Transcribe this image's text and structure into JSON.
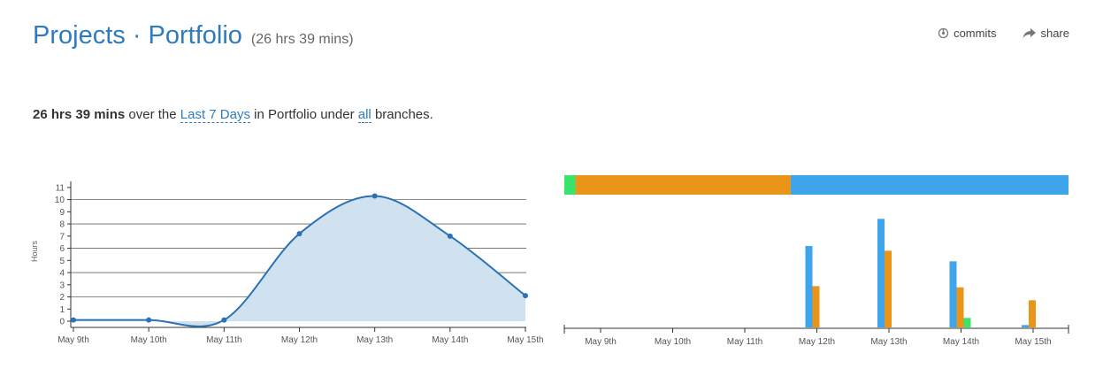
{
  "header": {
    "title": "Projects · Portfolio",
    "subtitle": "(26 hrs 39 mins)",
    "commits_label": "commits",
    "share_label": "share",
    "commits_icon": "commit-icon",
    "share_icon": "share-arrow-icon"
  },
  "summary": {
    "total": "26 hrs 39 mins",
    "text_over": "over the",
    "range_link": "Last 7 Days",
    "text_in": "in Portfolio under",
    "branch_link": "all",
    "text_end": "branches."
  },
  "colors": {
    "title": "#2f7bbf",
    "line": "#2a72b4",
    "area": "#d0e2f0",
    "blue": "#3ea5ea",
    "orange": "#ea951a",
    "green": "#3ae36a"
  },
  "chart_data": [
    {
      "type": "area",
      "ylabel": "Hours",
      "xlabel": "",
      "categories": [
        "May 9th",
        "May 10th",
        "May 11th",
        "May 12th",
        "May 13th",
        "May 14th",
        "May 15th"
      ],
      "values": [
        0.1,
        0.1,
        0.1,
        7.2,
        10.3,
        7.0,
        2.1
      ],
      "yticks": [
        0,
        1,
        2,
        3,
        4,
        5,
        6,
        7,
        8,
        9,
        10,
        11
      ],
      "ylim": [
        0,
        11.5
      ],
      "grid": true
    },
    {
      "type": "bar",
      "stacked_summary": [
        {
          "color": "green",
          "fraction": 0.022
        },
        {
          "color": "orange",
          "fraction": 0.427
        },
        {
          "color": "blue",
          "fraction": 0.551
        }
      ],
      "categories": [
        "May 9th",
        "May 10th",
        "May 11th",
        "May 12th",
        "May 13th",
        "May 14th",
        "May 15th"
      ],
      "series": [
        {
          "color": "blue",
          "values": [
            0,
            0,
            0,
            6.9,
            9.2,
            5.6,
            0.2
          ]
        },
        {
          "color": "orange",
          "values": [
            0,
            0,
            0,
            3.5,
            6.5,
            3.4,
            2.3
          ]
        },
        {
          "color": "green",
          "values": [
            0,
            0,
            0,
            0,
            0,
            0.8,
            0
          ]
        }
      ],
      "ylim": [
        0,
        10.5
      ]
    }
  ]
}
